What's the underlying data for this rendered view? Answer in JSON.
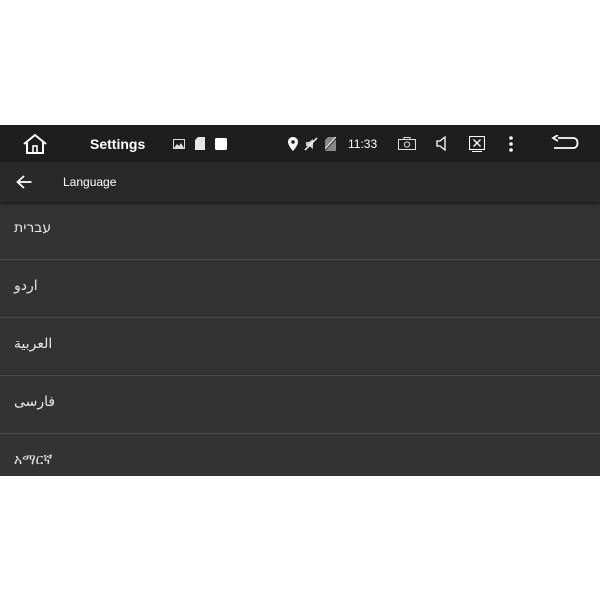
{
  "status_bar": {
    "title": "Settings",
    "time": "11:33",
    "icons": [
      "home-icon",
      "image-icon",
      "sd-card-icon",
      "square-icon",
      "location-icon",
      "mute-icon",
      "no-sim-icon",
      "camera-icon",
      "volume-icon",
      "close-screen-icon",
      "more-vert-icon",
      "back-return-icon"
    ]
  },
  "app_bar": {
    "title": "Language"
  },
  "languages": [
    {
      "label": "עברית"
    },
    {
      "label": "اردو"
    },
    {
      "label": "العربية"
    },
    {
      "label": "فارسی"
    },
    {
      "label": "አማርኛ"
    }
  ],
  "colors": {
    "status_bar_bg": "#1e1e1e",
    "app_bar_bg": "#292929",
    "list_bg": "#333333",
    "divider": "#4a4a4a"
  }
}
